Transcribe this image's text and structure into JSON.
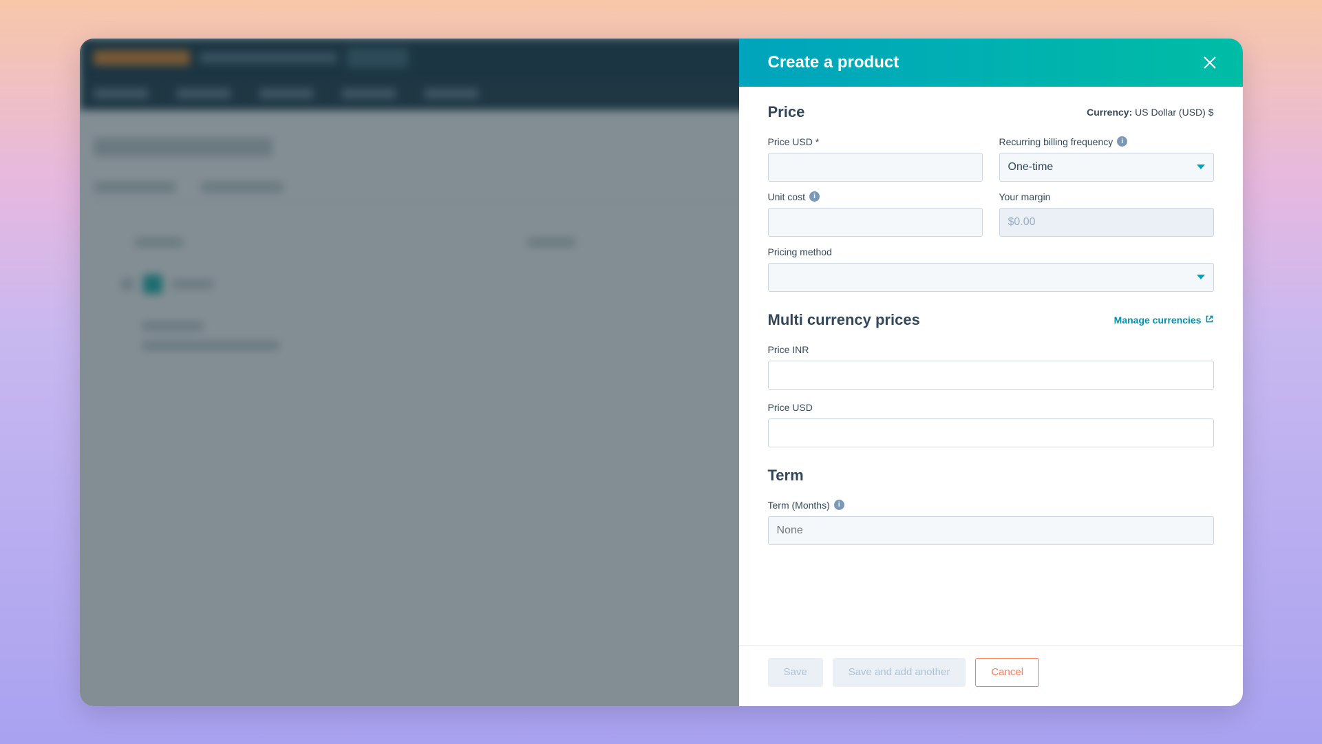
{
  "panel": {
    "title": "Create a product",
    "sections": {
      "price": {
        "title": "Price",
        "currency_prefix": "Currency:",
        "currency_value": "US Dollar (USD) $",
        "price_usd_label": "Price USD *",
        "price_usd_value": "",
        "billing_freq_label": "Recurring billing frequency",
        "billing_freq_value": "One-time",
        "unit_cost_label": "Unit cost",
        "unit_cost_value": "",
        "margin_label": "Your margin",
        "margin_value": "$0.00",
        "pricing_method_label": "Pricing method",
        "pricing_method_value": ""
      },
      "multicurrency": {
        "title": "Multi currency prices",
        "manage_link": "Manage currencies",
        "price_inr_label": "Price INR",
        "price_inr_value": "",
        "price_usd_label": "Price USD",
        "price_usd_value": ""
      },
      "term": {
        "title": "Term",
        "term_label": "Term (Months)",
        "term_placeholder": "None"
      }
    }
  },
  "footer": {
    "save": "Save",
    "save_add": "Save and add another",
    "cancel": "Cancel"
  }
}
